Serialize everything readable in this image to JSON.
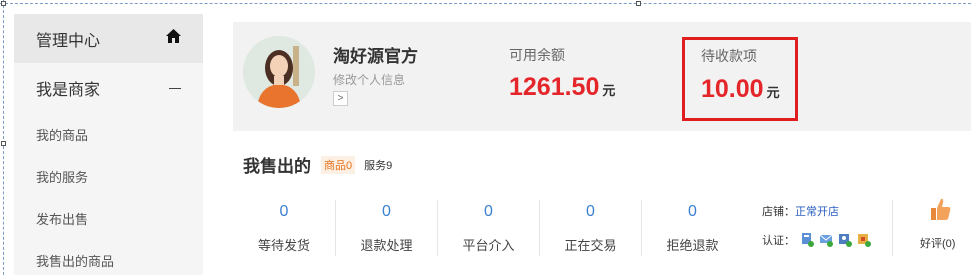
{
  "sidebar": {
    "header": {
      "label": "管理中心",
      "icon": "home-icon"
    },
    "group": {
      "label": "我是商家",
      "icon": "minus-icon"
    },
    "items": [
      {
        "label": "我的商品"
      },
      {
        "label": "我的服务"
      },
      {
        "label": "发布出售"
      },
      {
        "label": "我售出的商品"
      }
    ]
  },
  "account": {
    "name": "淘好源官方",
    "edit_label": "修改个人信息",
    "arrow": ">",
    "balance_label": "可用余额",
    "balance_value": "1261.50",
    "balance_unit": "元",
    "pending_label": "待收款项",
    "pending_value": "10.00",
    "pending_unit": "元",
    "highlight_color": "#e01e1e",
    "amount_color": "#e4262b"
  },
  "sold": {
    "title": "我售出的",
    "goods_tag": "商品0",
    "service_tag": "服务9"
  },
  "stats": [
    {
      "value": "0",
      "label": "等待发货"
    },
    {
      "value": "0",
      "label": "退款处理"
    },
    {
      "value": "0",
      "label": "平台介入"
    },
    {
      "value": "0",
      "label": "正在交易"
    },
    {
      "value": "0",
      "label": "拒绝退款"
    }
  ],
  "shop": {
    "label": "店铺：",
    "status": "正常开店",
    "cert_label": "认证：",
    "cert_icons": [
      "id-cert-icon",
      "email-cert-icon",
      "identity-cert-icon",
      "safety-cert-icon"
    ]
  },
  "rating": {
    "label": "好评(0)",
    "icon": "thumbs-up-icon"
  }
}
